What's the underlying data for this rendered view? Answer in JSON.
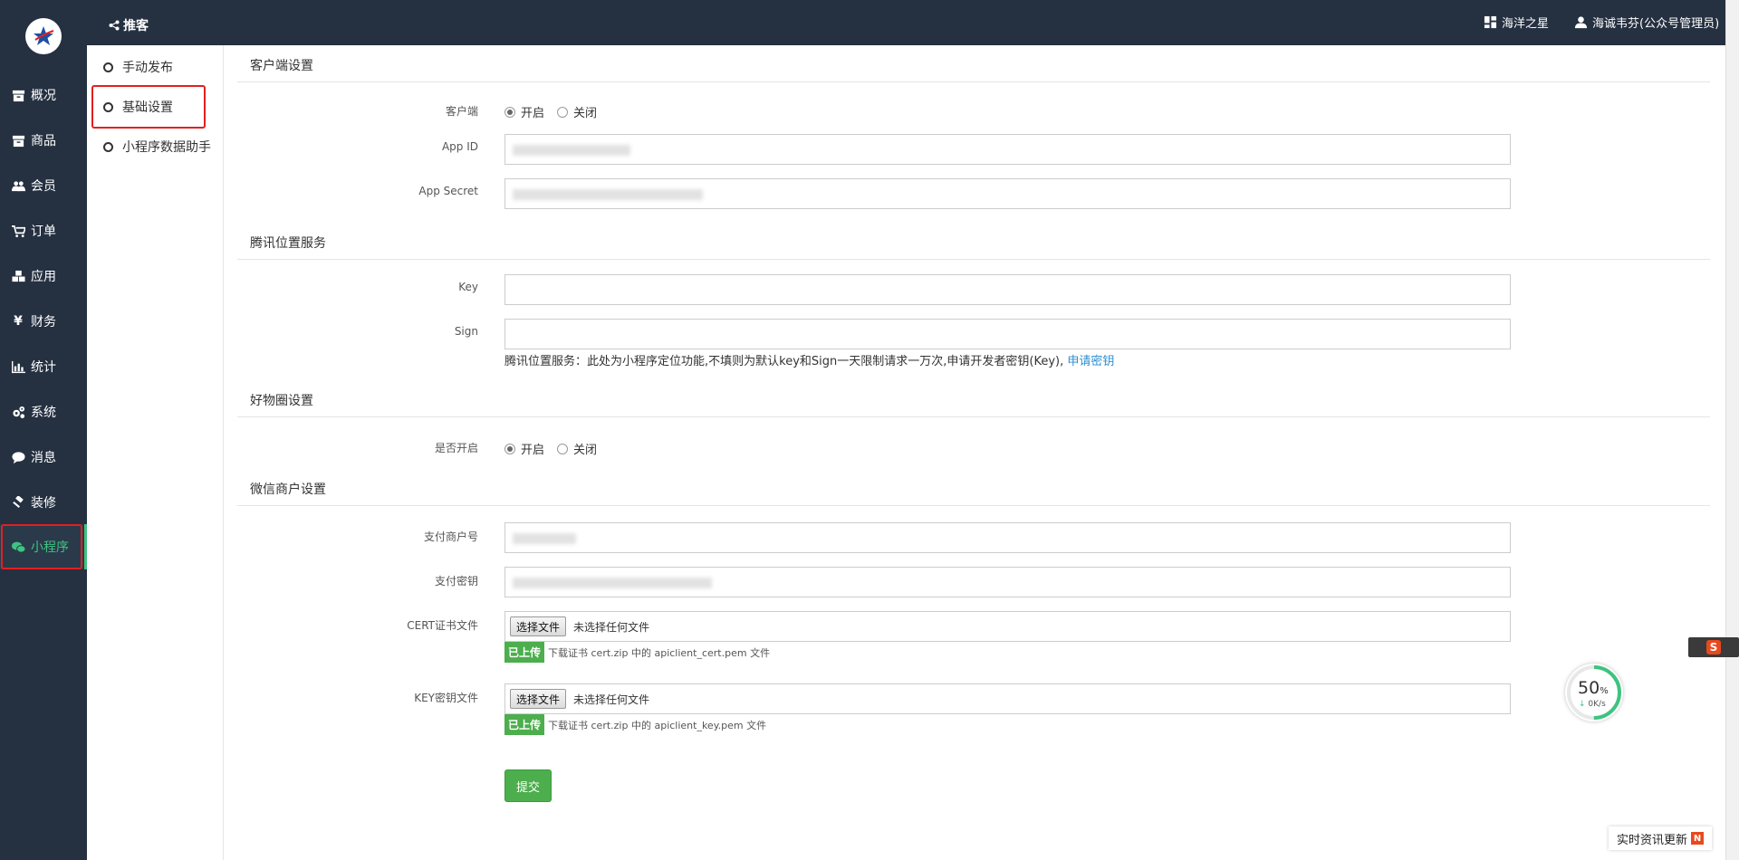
{
  "header": {
    "breadcrumb": "推客",
    "store_name": "海洋之星",
    "user_name": "海诚韦芬(公众号管理员)"
  },
  "leftnav": {
    "items": [
      {
        "label": "概况",
        "icon": "archive-icon"
      },
      {
        "label": "商品",
        "icon": "archive-icon"
      },
      {
        "label": "会员",
        "icon": "users-icon"
      },
      {
        "label": "订单",
        "icon": "cart-icon"
      },
      {
        "label": "应用",
        "icon": "cubes-icon"
      },
      {
        "label": "财务",
        "icon": "yen-icon"
      },
      {
        "label": "统计",
        "icon": "bar-chart-icon"
      },
      {
        "label": "系统",
        "icon": "gears-icon"
      },
      {
        "label": "消息",
        "icon": "comment-icon"
      },
      {
        "label": "装修",
        "icon": "gavel-icon"
      },
      {
        "label": "小程序",
        "icon": "wechat-icon",
        "active": true
      }
    ]
  },
  "submenu": {
    "items": [
      {
        "label": "手动发布"
      },
      {
        "label": "基础设置",
        "active": true
      },
      {
        "label": "小程序数据助手"
      }
    ]
  },
  "client_section": {
    "title": "客户端设置",
    "client_label": "客户端",
    "client_on": "开启",
    "client_off": "关闭",
    "appid_label": "App ID",
    "secret_label": "App Secret"
  },
  "tencent_section": {
    "title": "腾讯位置服务",
    "key_label": "Key",
    "sign_label": "Sign",
    "help_text": "腾讯位置服务：此处为小程序定位功能,不填则为默认key和Sign一天限制请求一万次,申请开发者密钥(Key),",
    "help_link": "申请密钥"
  },
  "goods_section": {
    "title": "好物圈设置",
    "enable_label": "是否开启",
    "on": "开启",
    "off": "关闭"
  },
  "wechat_section": {
    "title": "微信商户设置",
    "merchant_label": "支付商户号",
    "paykey_label": "支付密钥",
    "cert_label": "CERT证书文件",
    "key_label": "KEY密钥文件",
    "choose_file": "选择文件",
    "no_file": "未选择任何文件",
    "uploaded_tag": "已上传",
    "cert_hint": "下载证书 cert.zip 中的 apiclient_cert.pem 文件",
    "key_hint": "下载证书 cert.zip 中的 apiclient_key.pem 文件"
  },
  "submit_label": "提交",
  "widgets": {
    "speed_percent": "50",
    "speed_unit": "%",
    "speed_rate": "0K/s",
    "news_label": "实时资讯更新",
    "news_badge": "N",
    "ime_badge": "S"
  },
  "colors": {
    "nav_bg": "#253041",
    "accent_green": "#3fc380",
    "button_green": "#4cae4c",
    "link_blue": "#2a8fd2",
    "highlight_red": "#e02020"
  }
}
